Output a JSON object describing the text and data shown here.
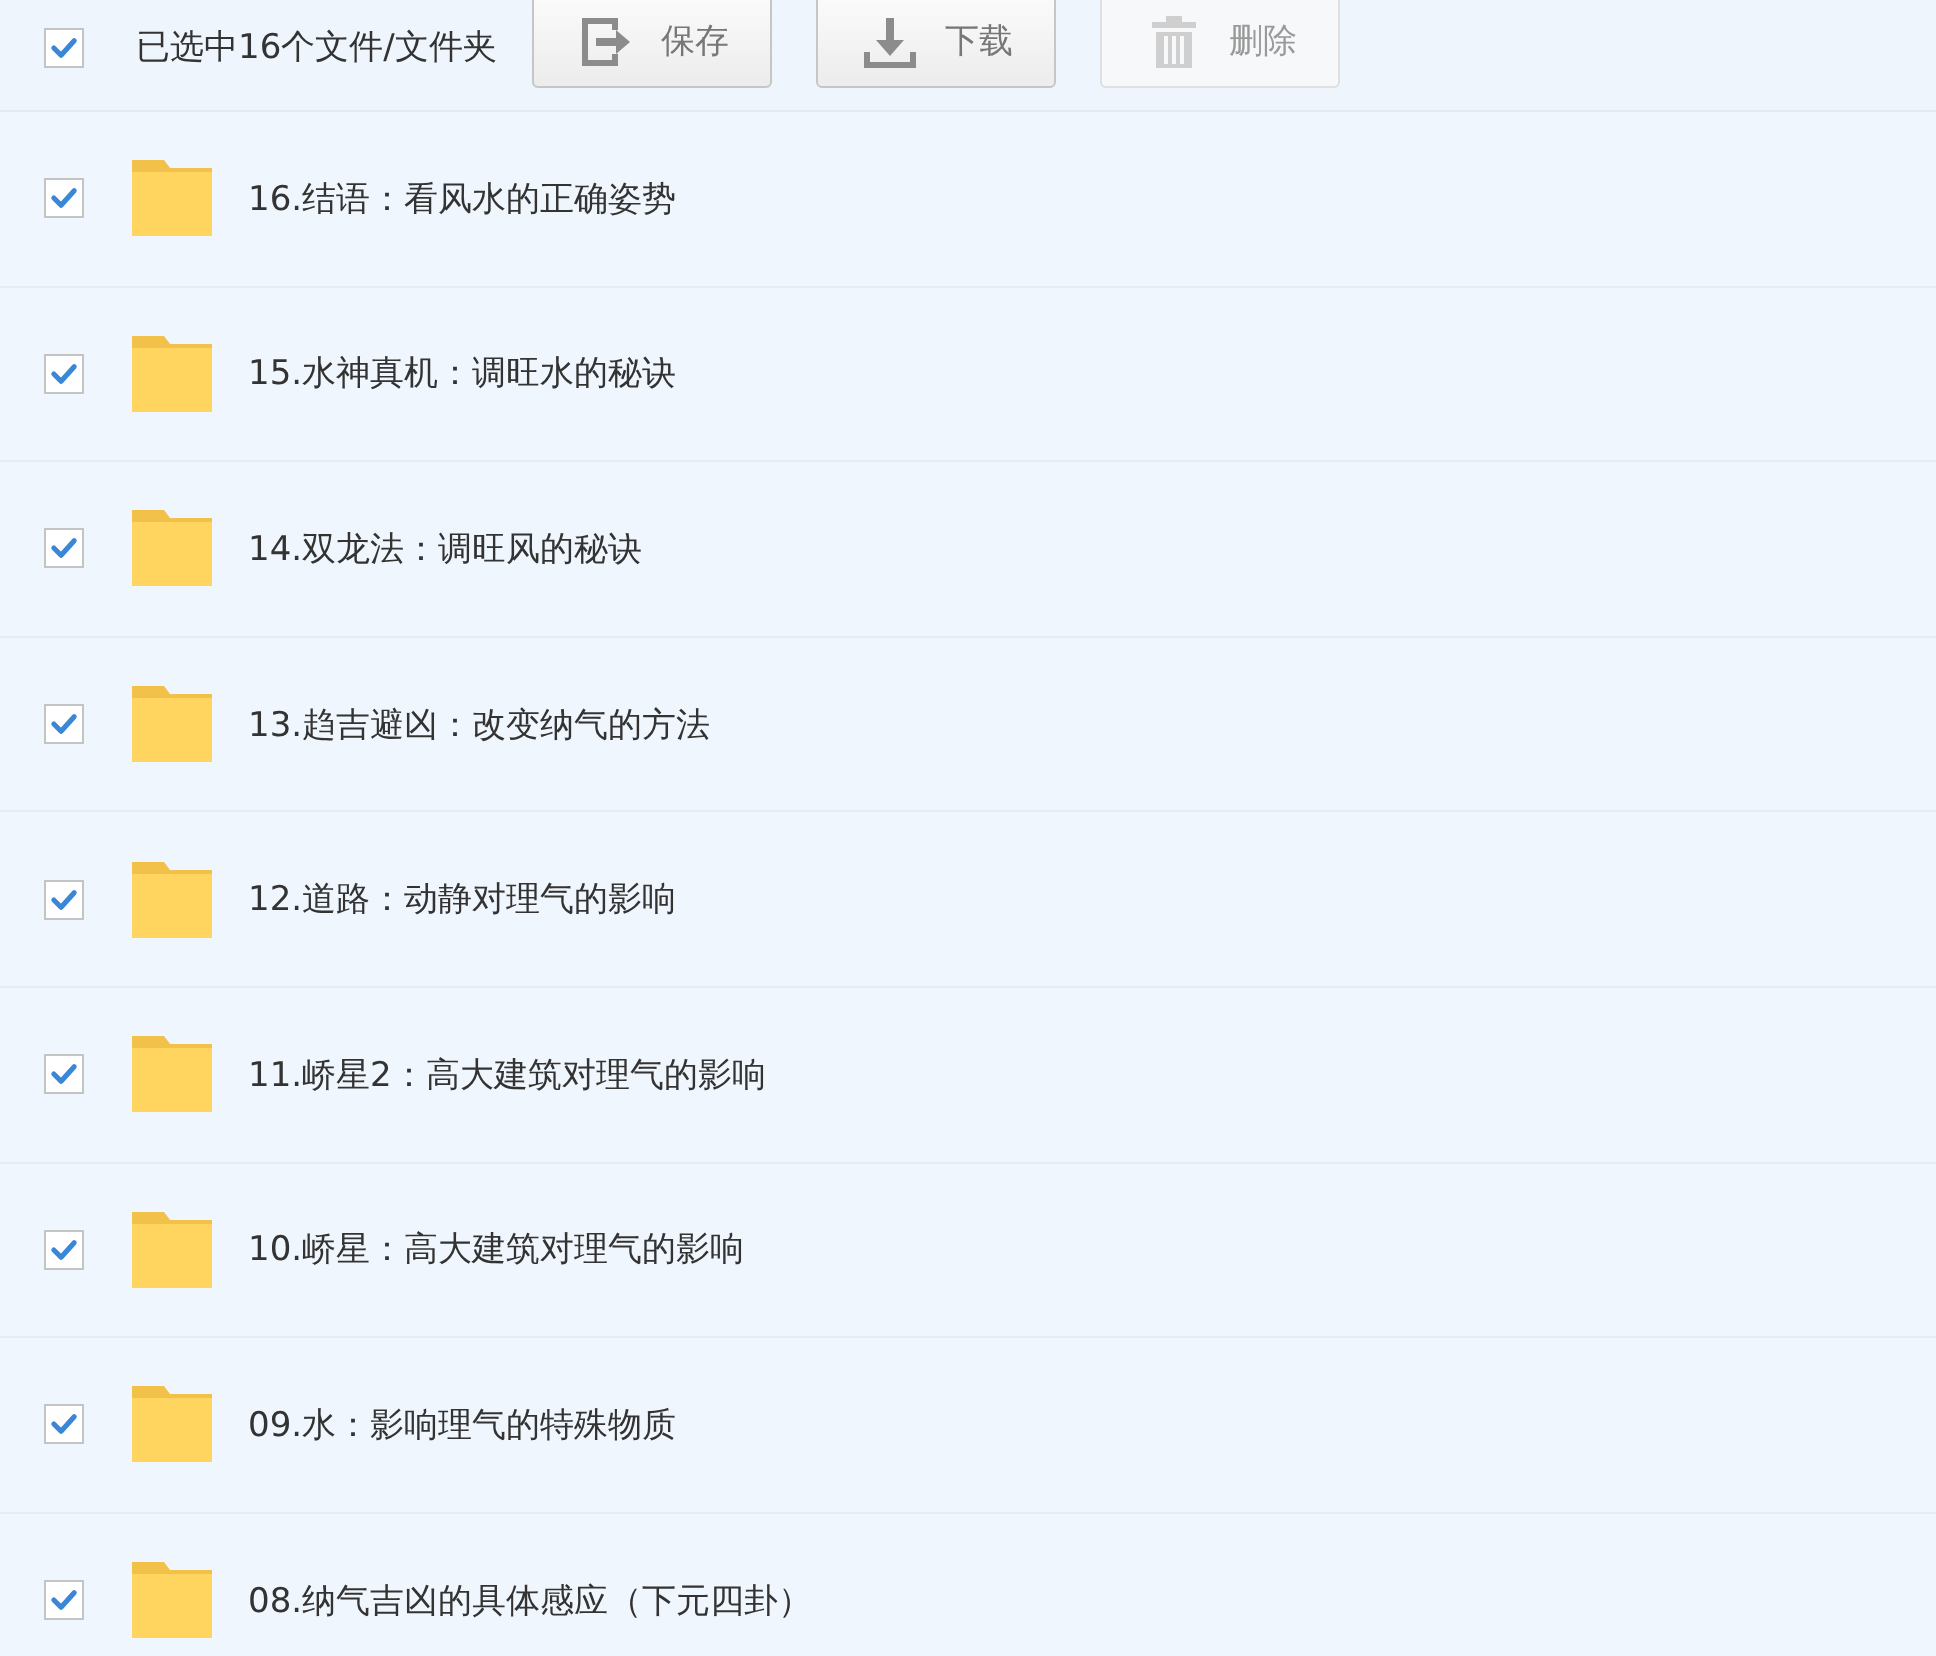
{
  "toolbar": {
    "select_all": {
      "checked": true
    },
    "summary": "已选中16个文件/文件夹",
    "buttons": [
      {
        "kind": "save",
        "label": "保存",
        "disabled": false
      },
      {
        "kind": "download",
        "label": "下载",
        "disabled": false
      },
      {
        "kind": "delete",
        "label": "删除",
        "disabled": true
      }
    ]
  },
  "files": [
    {
      "name": "16.结语：看风水的正确姿势",
      "checked": true
    },
    {
      "name": "15.水神真机：调旺水的秘诀",
      "checked": true
    },
    {
      "name": "14.双龙法：调旺风的秘诀",
      "checked": true
    },
    {
      "name": "13.趋吉避凶：改变纳气的方法",
      "checked": true
    },
    {
      "name": "12.道路：动静对理气的影响",
      "checked": true
    },
    {
      "name": "11.峤星2：高大建筑对理气的影响",
      "checked": true
    },
    {
      "name": "10.峤星：高大建筑对理气的影响",
      "checked": true
    },
    {
      "name": "09.水：影响理气的特殊物质",
      "checked": true
    },
    {
      "name": "08.纳气吉凶的具体感应（下元四卦）",
      "checked": true
    }
  ]
}
